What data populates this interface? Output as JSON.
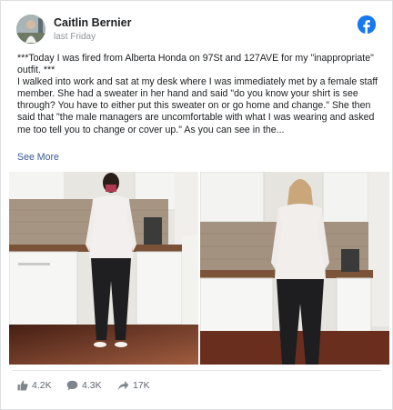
{
  "post": {
    "author": "Caitlin Bernier",
    "timestamp": "last Friday",
    "logo_icon": "facebook-logo-icon",
    "paragraphs": [
      "***Today I was fired from Alberta Honda on 97St and 127AVE for my \"inappropriate\" outfit. ***",
      "I walked into work and sat at my desk where I was immediately met by a female staff member. She had a sweater in her hand and said \"do you know your shirt is see through? You have to either put this sweater on or go home and change.\" She then said that \"the male managers are uncomfortable with what I was wearing and asked me too tell you to change or cover up.\" As you can see in the..."
    ],
    "see_more": "See More",
    "photos": [
      {
        "subject": "woman-front-view",
        "alt": "Photo of woman in white top and black pants, front view in kitchen"
      },
      {
        "subject": "woman-back-view",
        "alt": "Photo of woman in white top and black pants, back view in kitchen"
      }
    ]
  },
  "footer": {
    "likes": "4.2K",
    "comments": "4.3K",
    "shares": "17K",
    "like_icon": "thumbs-up-icon",
    "comment_icon": "comment-icon",
    "share_icon": "share-arrow-icon"
  },
  "colors": {
    "brand": "#1877f2",
    "link": "#385898",
    "muted": "#90949c"
  }
}
